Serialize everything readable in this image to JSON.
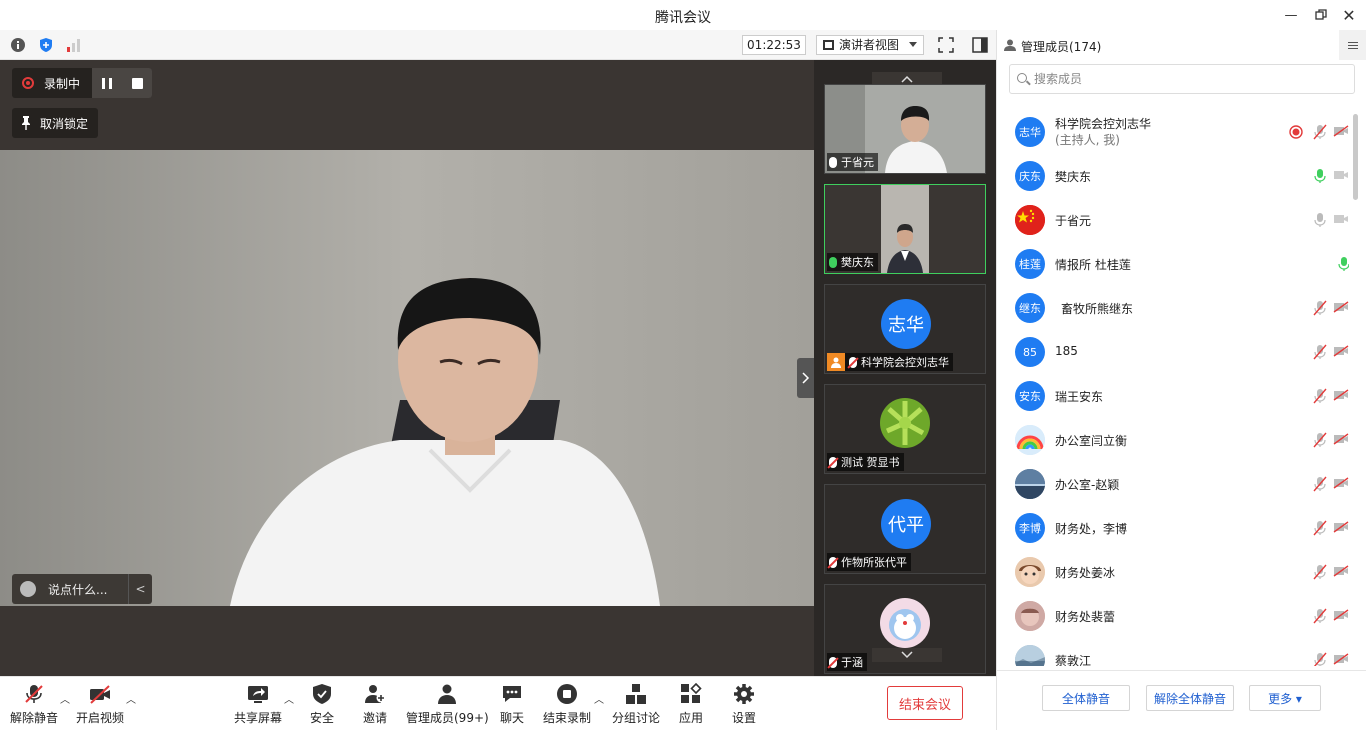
{
  "window": {
    "title": "腾讯会议"
  },
  "topbar": {
    "timer": "01:22:53",
    "view_label": "演讲者视图"
  },
  "stage": {
    "recording_label": "录制中",
    "unpin_label": "取消锁定",
    "chat_placeholder": "说点什么...",
    "chat_toggle": "<"
  },
  "tiles": [
    {
      "name": "于省元",
      "mic": "on"
    },
    {
      "name": "樊庆东",
      "mic": "speaking"
    },
    {
      "name": "科学院会控刘志华",
      "avatar": "志华",
      "mic": "muted"
    },
    {
      "name": "测试 贺显书",
      "mic": "muted"
    },
    {
      "name": "作物所张代平",
      "avatar": "代平",
      "mic": "muted"
    },
    {
      "name": "于涵",
      "mic": "muted"
    }
  ],
  "toolbar": {
    "unmute": "解除静音",
    "video": "开启视频",
    "share": "共享屏幕",
    "security": "安全",
    "invite": "邀请",
    "members": "管理成员(99+)",
    "chat": "聊天",
    "end_record": "结束录制",
    "breakout": "分组讨论",
    "apps": "应用",
    "settings": "设置",
    "end_meeting": "结束会议"
  },
  "panel": {
    "title": "管理成员(174)",
    "search_placeholder": "搜索成员",
    "members": [
      {
        "avatar": "志华",
        "name": "科学院会控刘志华",
        "sub": "(主持人, 我)",
        "recording": true,
        "mic": "muted",
        "cam": "off"
      },
      {
        "avatar": "庆东",
        "name": "樊庆东",
        "mic": "green",
        "cam": "idle"
      },
      {
        "avatar": "",
        "name": "于省元",
        "mic": "gray",
        "cam": "idle"
      },
      {
        "avatar": "桂莲",
        "name": "情报所 杜桂莲",
        "mic": "green",
        "cam": "none"
      },
      {
        "avatar": "继东",
        "name": "畜牧所熊继东",
        "mic": "muted",
        "cam": "off"
      },
      {
        "avatar": "85",
        "name": "185",
        "mic": "muted",
        "cam": "off"
      },
      {
        "avatar": "安东",
        "name": "瑞王安东",
        "mic": "muted",
        "cam": "off"
      },
      {
        "avatar": "",
        "name": "办公室闫立衡",
        "mic": "muted",
        "cam": "off"
      },
      {
        "avatar": "",
        "name": "办公室-赵颖",
        "mic": "muted",
        "cam": "off"
      },
      {
        "avatar": "李博",
        "name": "财务处，李博",
        "mic": "muted",
        "cam": "off"
      },
      {
        "avatar": "",
        "name": "财务处姜冰",
        "mic": "muted",
        "cam": "off"
      },
      {
        "avatar": "",
        "name": "财务处裴蕾",
        "mic": "muted",
        "cam": "off"
      },
      {
        "avatar": "",
        "name": "蔡敦江",
        "mic": "muted",
        "cam": "off"
      }
    ],
    "mute_all": "全体静音",
    "unmute_all": "解除全体静音",
    "more": "更多 ▾"
  }
}
